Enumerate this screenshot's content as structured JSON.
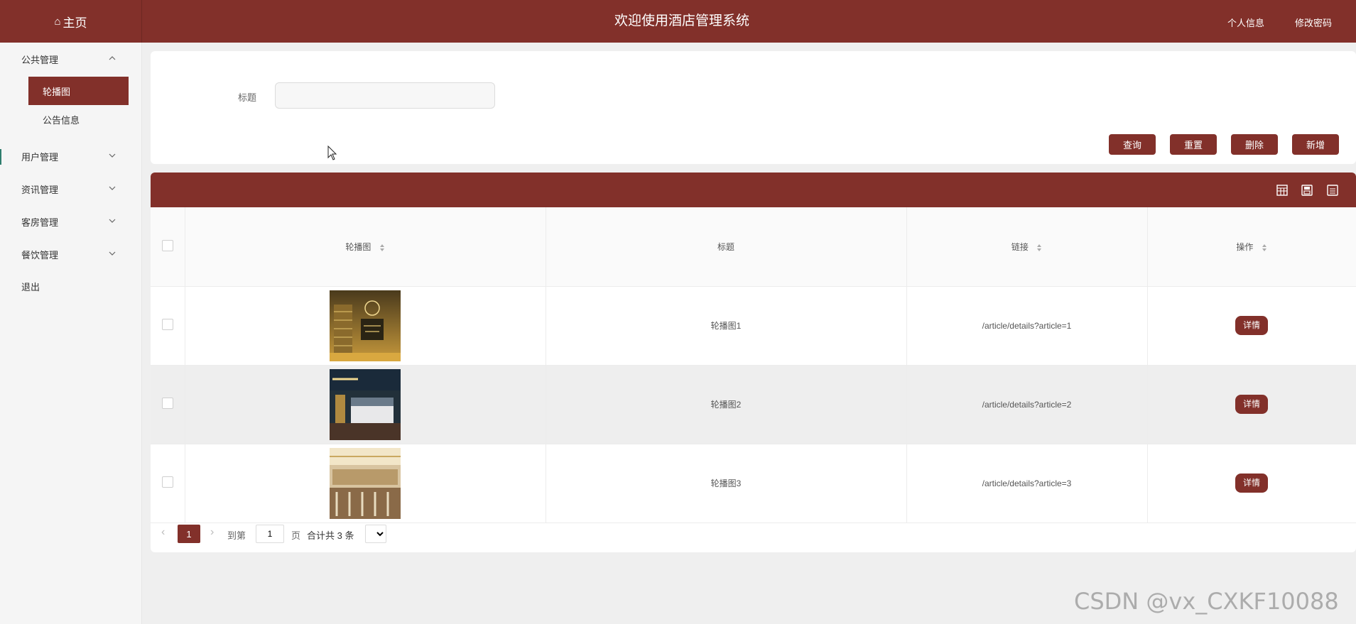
{
  "header": {
    "home_label": "主页",
    "title": "欢迎使用酒店管理系统",
    "profile_label": "个人信息",
    "password_label": "修改密码",
    "bg_color": "#82302a"
  },
  "sidebar": {
    "groups": [
      {
        "label": "公共管理",
        "expanded": true,
        "children": [
          {
            "label": "轮播图",
            "active": true
          },
          {
            "label": "公告信息",
            "active": false
          }
        ]
      },
      {
        "label": "用户管理",
        "expanded": false
      },
      {
        "label": "资讯管理",
        "expanded": false
      },
      {
        "label": "客房管理",
        "expanded": false
      },
      {
        "label": "餐饮管理",
        "expanded": false
      }
    ],
    "logout_label": "退出"
  },
  "search": {
    "label": "标题",
    "value": "",
    "buttons": {
      "query": "查询",
      "reset": "重置",
      "delete": "删除",
      "add": "新增"
    }
  },
  "table": {
    "toolbar_icons": [
      "export-excel-icon",
      "print-icon",
      "save-icon"
    ],
    "columns": [
      "轮播图",
      "标题",
      "链接",
      "操作"
    ],
    "rows": [
      {
        "title": "轮播图1",
        "link": "/article/details?article=1",
        "action": "详情"
      },
      {
        "title": "轮播图2",
        "link": "/article/details?article=2",
        "action": "详情"
      },
      {
        "title": "轮播图3",
        "link": "/article/details?article=3",
        "action": "详情"
      }
    ]
  },
  "pagination": {
    "current_page": "1",
    "goto_label": "到第",
    "page_input_value": "1",
    "page_unit": "页",
    "total_text": "合计共 3 条"
  },
  "watermark": "CSDN @vx_CXKF10088"
}
